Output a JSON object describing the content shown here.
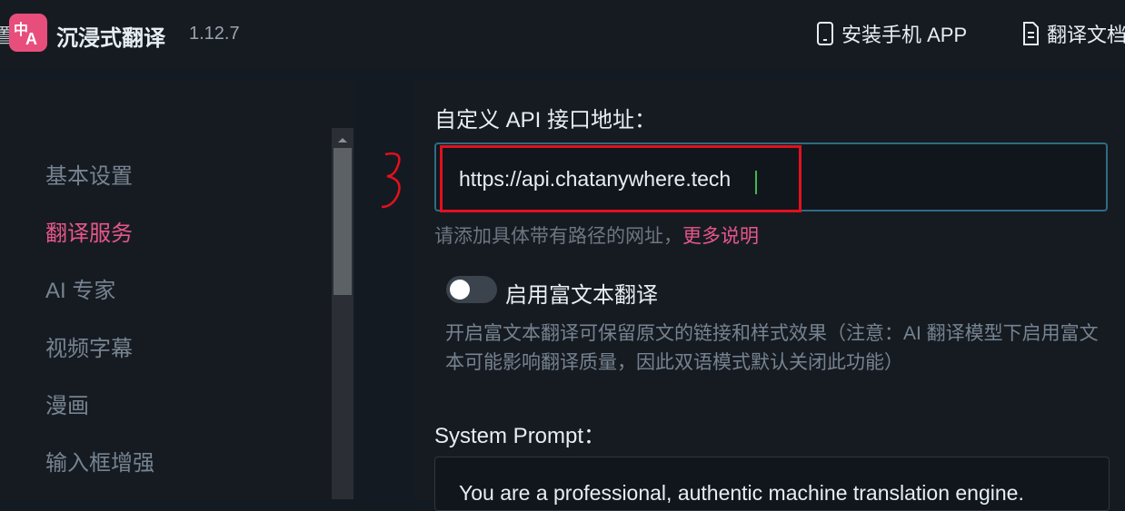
{
  "header": {
    "edge_char": "置",
    "logo_chars": [
      "中",
      "A"
    ],
    "app_name": "沉浸式翻译",
    "version": "1.12.7",
    "install_label": "安装手机 APP",
    "doc_label": "翻译文档",
    "install_icon": "phone-icon",
    "doc_icon": "document-icon"
  },
  "sidebar": {
    "items": [
      {
        "label": "基本设置",
        "active": false
      },
      {
        "label": "翻译服务",
        "active": true
      },
      {
        "label": "AI 专家",
        "active": false
      },
      {
        "label": "视频字幕",
        "active": false
      },
      {
        "label": "漫画",
        "active": false
      },
      {
        "label": "输入框增强",
        "active": false
      }
    ]
  },
  "main": {
    "api_label": "自定义 API 接口地址：",
    "api_value": "https://api.chatanywhere.tech",
    "hint_text": "请添加具体带有路径的网址，",
    "hint_link": "更多说明",
    "rich_text_label": "启用富文本翻译",
    "rich_text_enabled": false,
    "rich_text_desc": "开启富文本翻译可保留原文的链接和样式效果（注意：AI 翻译模型下启用富文本可能影响翻译质量，因此双语模式默认关闭此功能）",
    "system_prompt_label": "System Prompt：",
    "system_prompt_value": "You are a professional, authentic machine translation engine."
  },
  "colors": {
    "accent": "#e8568a",
    "annotation_red": "#e3101d",
    "input_border": "#2f6b84"
  }
}
